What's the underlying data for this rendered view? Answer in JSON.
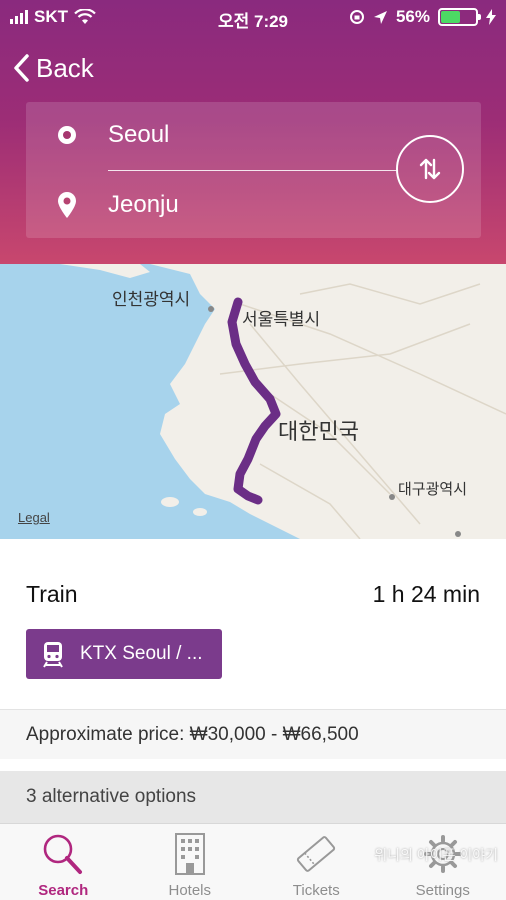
{
  "status_bar": {
    "carrier": "SKT",
    "time": "오전 7:29",
    "battery_percent": "56%",
    "battery_level": 0.56
  },
  "nav": {
    "back_label": "Back"
  },
  "route": {
    "origin": "Seoul",
    "destination": "Jeonju"
  },
  "map": {
    "labels": {
      "incheon": "인천광역시",
      "seoul": "서울특별시",
      "korea": "대한민국",
      "daegu": "대구광역시"
    },
    "legal": "Legal",
    "route_color": "#6b2e86"
  },
  "result": {
    "mode": "Train",
    "duration": "1 h 24 min",
    "train_button": "KTX Seoul / ...",
    "price": "Approximate price: ₩30,000 - ₩66,500",
    "alternatives": "3 alternative options"
  },
  "tabs": [
    {
      "label": "Search",
      "icon": "search-icon",
      "active": true
    },
    {
      "label": "Hotels",
      "icon": "hotel-icon",
      "active": false
    },
    {
      "label": "Tickets",
      "icon": "ticket-icon",
      "active": false
    },
    {
      "label": "Settings",
      "icon": "gear-icon",
      "active": false
    }
  ],
  "watermark": "위니의 아이폰 이야기",
  "colors": {
    "accent": "#b0277f",
    "header_top": "#8a2a7e",
    "header_bottom": "#c8476e",
    "button": "#7b3b8c"
  }
}
